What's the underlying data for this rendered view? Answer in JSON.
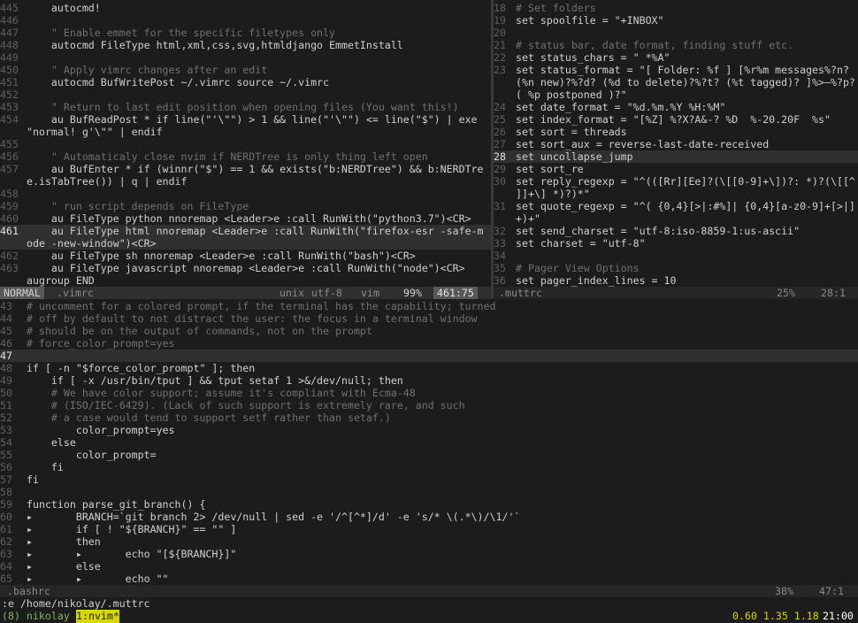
{
  "top_left_pane": {
    "lines": [
      {
        "n": "445",
        "t": "    autocmd!"
      },
      {
        "n": "446",
        "t": ""
      },
      {
        "n": "447",
        "t": "    \" Enable emmet for the specific filetypes only",
        "c": "cm"
      },
      {
        "n": "448",
        "t": "    autocmd FileType html,xml,css,svg,htmldjango EmmetInstall"
      },
      {
        "n": "449",
        "t": ""
      },
      {
        "n": "450",
        "t": "    \" Apply vimrc changes after an edit",
        "c": "cm"
      },
      {
        "n": "451",
        "t": "    autocmd BufWritePost ~/.vimrc source ~/.vimrc"
      },
      {
        "n": "452",
        "t": ""
      },
      {
        "n": "453",
        "t": "    \" Return to last edit position when opening files (You want this!)",
        "c": "cm"
      },
      {
        "n": "454",
        "t": "    au BufReadPost * if line(\"'\\\"\") > 1 && line(\"'\\\"\") <= line(\"$\") | exe"
      },
      {
        "n": "",
        "t": "\"normal! g'\\\"\" | endif"
      },
      {
        "n": "455",
        "t": ""
      },
      {
        "n": "456",
        "t": "    \" Automaticaly close nvim if NERDTree is only thing left open",
        "c": "cm"
      },
      {
        "n": "457",
        "t": "    au BufEnter * if (winnr(\"$\") == 1 && exists(\"b:NERDTree\") && b:NERDTre"
      },
      {
        "n": "",
        "t": "e.isTabTree()) | q | endif"
      },
      {
        "n": "458",
        "t": ""
      },
      {
        "n": "459",
        "t": "    \" run script depends on FileType",
        "c": "cm"
      },
      {
        "n": "460",
        "t": "    au FileType python nnoremap <Leader>e :call RunWith(\"python3.7\")<CR>"
      },
      {
        "n": "461",
        "t": "    au FileType html nnoremap <Leader>e :call RunWith(\"firefox-esr -safe-m",
        "cur": true
      },
      {
        "n": "",
        "t": "ode -new-window\")<CR>",
        "cur": true
      },
      {
        "n": "462",
        "t": "    au FileType sh nnoremap <Leader>e :call RunWith(\"bash\")<CR>"
      },
      {
        "n": "463",
        "t": "    au FileType javascript nnoremap <Leader>e :call RunWith(\"node\")<CR>"
      },
      {
        "n": "",
        "t": "augroup END"
      }
    ],
    "status": {
      "mode": "NORMAL",
      "file": ".vimrc",
      "format": "unix",
      "encoding": "utf-8",
      "filetype": "vim",
      "percent": "99%",
      "position": "461:75"
    }
  },
  "top_right_pane": {
    "lines": [
      {
        "n": "18",
        "t": "# Set folders",
        "c": "cm"
      },
      {
        "n": "19",
        "t": "set spoolfile = \"+INBOX\""
      },
      {
        "n": "20",
        "t": ""
      },
      {
        "n": "21",
        "t": "# status bar, date format, finding stuff etc.",
        "c": "cm"
      },
      {
        "n": "22",
        "t": "set status_chars = \" *%A\""
      },
      {
        "n": "23",
        "t": "set status_format = \"[ Folder: %f ] [%r%m messages%?n?"
      },
      {
        "n": "",
        "t": "(%n new)?%?d? (%d to delete)?%?t? (%t tagged)? ]%>—%?p?"
      },
      {
        "n": "",
        "t": "( %p postponed )?\""
      },
      {
        "n": "24",
        "t": "set date_format = \"%d.%m.%Y %H:%M\""
      },
      {
        "n": "25",
        "t": "set index_format = \"[%Z] %?X?A&-? %D  %-20.20F  %s\""
      },
      {
        "n": "26",
        "t": "set sort = threads"
      },
      {
        "n": "27",
        "t": "set sort_aux = reverse-last-date-received"
      },
      {
        "n": "28",
        "t": "set uncollapse_jump",
        "cur": true
      },
      {
        "n": "29",
        "t": "set sort_re"
      },
      {
        "n": "30",
        "t": "set reply_regexp = \"^(([Rr][Ee]?(\\[[0-9]+\\])?: *)?(\\[[^"
      },
      {
        "n": "",
        "t": "]]+\\] *)?)*\""
      },
      {
        "n": "31",
        "t": "set quote_regexp = \"^( {0,4}[>|:#%]| {0,4}[a-z0-9]+[>|]"
      },
      {
        "n": "",
        "t": "+)+\""
      },
      {
        "n": "32",
        "t": "set send_charset = \"utf-8:iso-8859-1:us-ascii\""
      },
      {
        "n": "33",
        "t": "set charset = \"utf-8\""
      },
      {
        "n": "34",
        "t": ""
      },
      {
        "n": "35",
        "t": "# Pager View Options",
        "c": "cm"
      },
      {
        "n": "36",
        "t": "set pager_index_lines = 10"
      }
    ],
    "status": {
      "file": ".muttrc",
      "percent": "25%",
      "position": "28:1"
    }
  },
  "bottom_pane": {
    "lines": [
      {
        "n": "43",
        "t": "# uncomment for a colored prompt, if the terminal has the capability; turned",
        "c": "cm"
      },
      {
        "n": "44",
        "t": "# off by default to not distract the user: the focus in a terminal window",
        "c": "cm"
      },
      {
        "n": "45",
        "t": "# should be on the output of commands, not on the prompt",
        "c": "cm"
      },
      {
        "n": "46",
        "t": "# force_color_prompt=yes",
        "c": "cm"
      },
      {
        "n": "47",
        "t": "",
        "cur": true
      },
      {
        "n": "48",
        "t": "if [ -n \"$force_color_prompt\" ]; then"
      },
      {
        "n": "49",
        "t": "    if [ -x /usr/bin/tput ] && tput setaf 1 >&/dev/null; then"
      },
      {
        "n": "50",
        "t": "    # We have color support; assume it's compliant with Ecma-48",
        "c": "cm"
      },
      {
        "n": "51",
        "t": "    # (ISO/IEC-6429). (Lack of such support is extremely rare, and such",
        "c": "cm"
      },
      {
        "n": "52",
        "t": "    # a case would tend to support setf rather than setaf.)",
        "c": "cm"
      },
      {
        "n": "53",
        "t": "        color_prompt=yes"
      },
      {
        "n": "54",
        "t": "    else"
      },
      {
        "n": "55",
        "t": "        color_prompt="
      },
      {
        "n": "56",
        "t": "    fi"
      },
      {
        "n": "57",
        "t": "fi"
      },
      {
        "n": "58",
        "t": ""
      },
      {
        "n": "59",
        "t": "function parse_git_branch() {"
      },
      {
        "n": "60",
        "t": "▸       BRANCH=`git branch 2> /dev/null | sed -e '/^[^*]/d' -e 's/* \\(.*\\)/\\1/'`"
      },
      {
        "n": "61",
        "t": "▸       if [ ! \"${BRANCH}\" == \"\" ]"
      },
      {
        "n": "62",
        "t": "▸       then"
      },
      {
        "n": "63",
        "t": "▸       ▸       echo \"[${BRANCH}]\""
      },
      {
        "n": "64",
        "t": "▸       else"
      },
      {
        "n": "65",
        "t": "▸       ▸       echo \"\""
      }
    ],
    "status": {
      "file": ".bashrc",
      "percent": "38%",
      "position": "47:1"
    }
  },
  "command_line": ":e /home/nikolay/.muttrc",
  "tmux": {
    "session": "(8) nikolay",
    "window": "1:nvim*",
    "load": "0.60 1.35 1.18",
    "time": "21:00"
  }
}
